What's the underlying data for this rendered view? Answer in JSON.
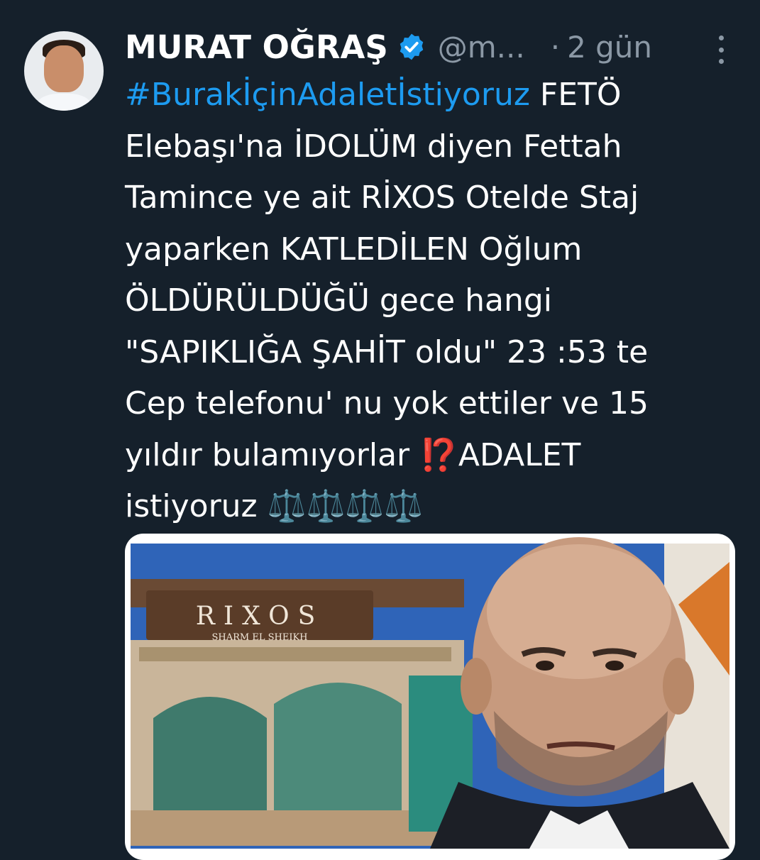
{
  "author": {
    "name": "MURAT OĞRAŞ",
    "handle": "@m...",
    "separator": "·",
    "time": "2 gün",
    "verified_icon": "verified-badge-icon",
    "avatar_icon": "profile-avatar"
  },
  "tweet": {
    "line1_hashtag": "#BurakİçinAdaletİstiyoruz",
    "line1_rest": " FETÖ",
    "line2": "Elebaşı'na İDOLÜM diyen Fettah",
    "line3": "Tamince ye ait RİXOS Otelde Staj",
    "line4": "yaparken KATLEDİLEN Oğlum",
    "line5": "ÖLDÜRÜLDÜĞÜ gece hangi",
    "line6": "\"SAPIKLIĞA ŞAHİT oldu\" 23 :53 te",
    "line7": "Cep telefonu' nu yok ettiler ve 15",
    "line8_pre": "yıldır bulamıyorlar ",
    "line8_emoji": "⁉️",
    "line8_post": "ADALET",
    "line9_pre": "istiyoruz ",
    "line9_emoji": "⚖️⚖️⚖️⚖️"
  },
  "media": {
    "sign_main": "RIXOS",
    "sign_sub": "SHARM EL SHEIKH"
  },
  "colors": {
    "background": "#15202b",
    "link": "#1d9bf0",
    "muted": "#8b98a5",
    "verified": "#1d9bf0"
  }
}
